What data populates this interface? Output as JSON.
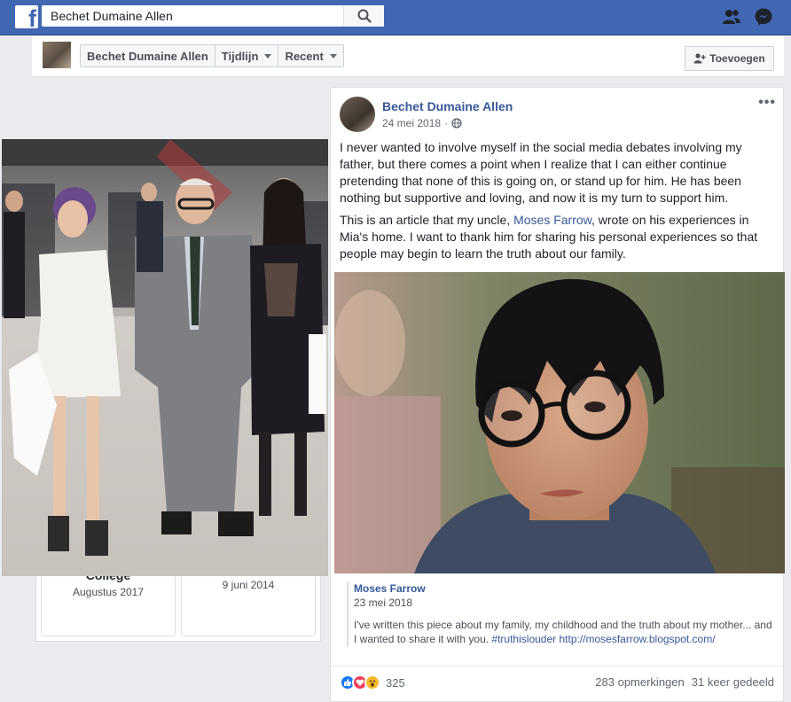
{
  "topbar": {
    "search_value": "Bechet Dumaine Allen",
    "logo_letter": "f",
    "icons": [
      "facebook-logo-icon",
      "search-icon",
      "friends-icon",
      "messenger-icon"
    ],
    "brand_color": "#4267b2"
  },
  "timeline_header": {
    "crumbs": [
      {
        "label": "Bechet Dumaine Allen",
        "has_caret": false
      },
      {
        "label": "Tijdlijn",
        "has_caret": true
      },
      {
        "label": "Recent",
        "has_caret": true
      }
    ],
    "add_button": "Toevoegen"
  },
  "left_column": {
    "events": [
      {
        "title": "College",
        "date": "Augustus 2017"
      },
      {
        "title": "",
        "date": "9 juni 2014"
      }
    ]
  },
  "post": {
    "author": "Bechet Dumaine Allen",
    "date": "24 mei 2018",
    "privacy_icon": "globe-icon",
    "paragraph1": "I never wanted to involve myself in the social media debates involving my father, but there comes a point when I realize that I can either continue pretending that none of this is going on, or stand up for him. He has been nothing but supportive and loving, and now it is my turn to support him.",
    "paragraph2_before": "This is an article that my uncle, ",
    "paragraph2_link": "Moses Farrow",
    "paragraph2_after": ", wrote on his experiences in Mia's home. I want to thank him for sharing his personal experiences so that people may begin to learn the truth about our family.",
    "link_preview": {
      "source": "Moses Farrow",
      "date": "23 mei 2018",
      "desc_before": "I've written this piece about my family, my childhood and the truth about my mother... and I wanted to share it with you. ",
      "hashtag": "#truthislouder",
      "desc_url": "http://mosesfarrow.blogspot.com/"
    },
    "reaction_icons": [
      "like-icon",
      "love-icon",
      "wow-icon"
    ],
    "reaction_count": "325",
    "comments": "283 opmerkingen",
    "shares": "31 keer gedeeld"
  }
}
